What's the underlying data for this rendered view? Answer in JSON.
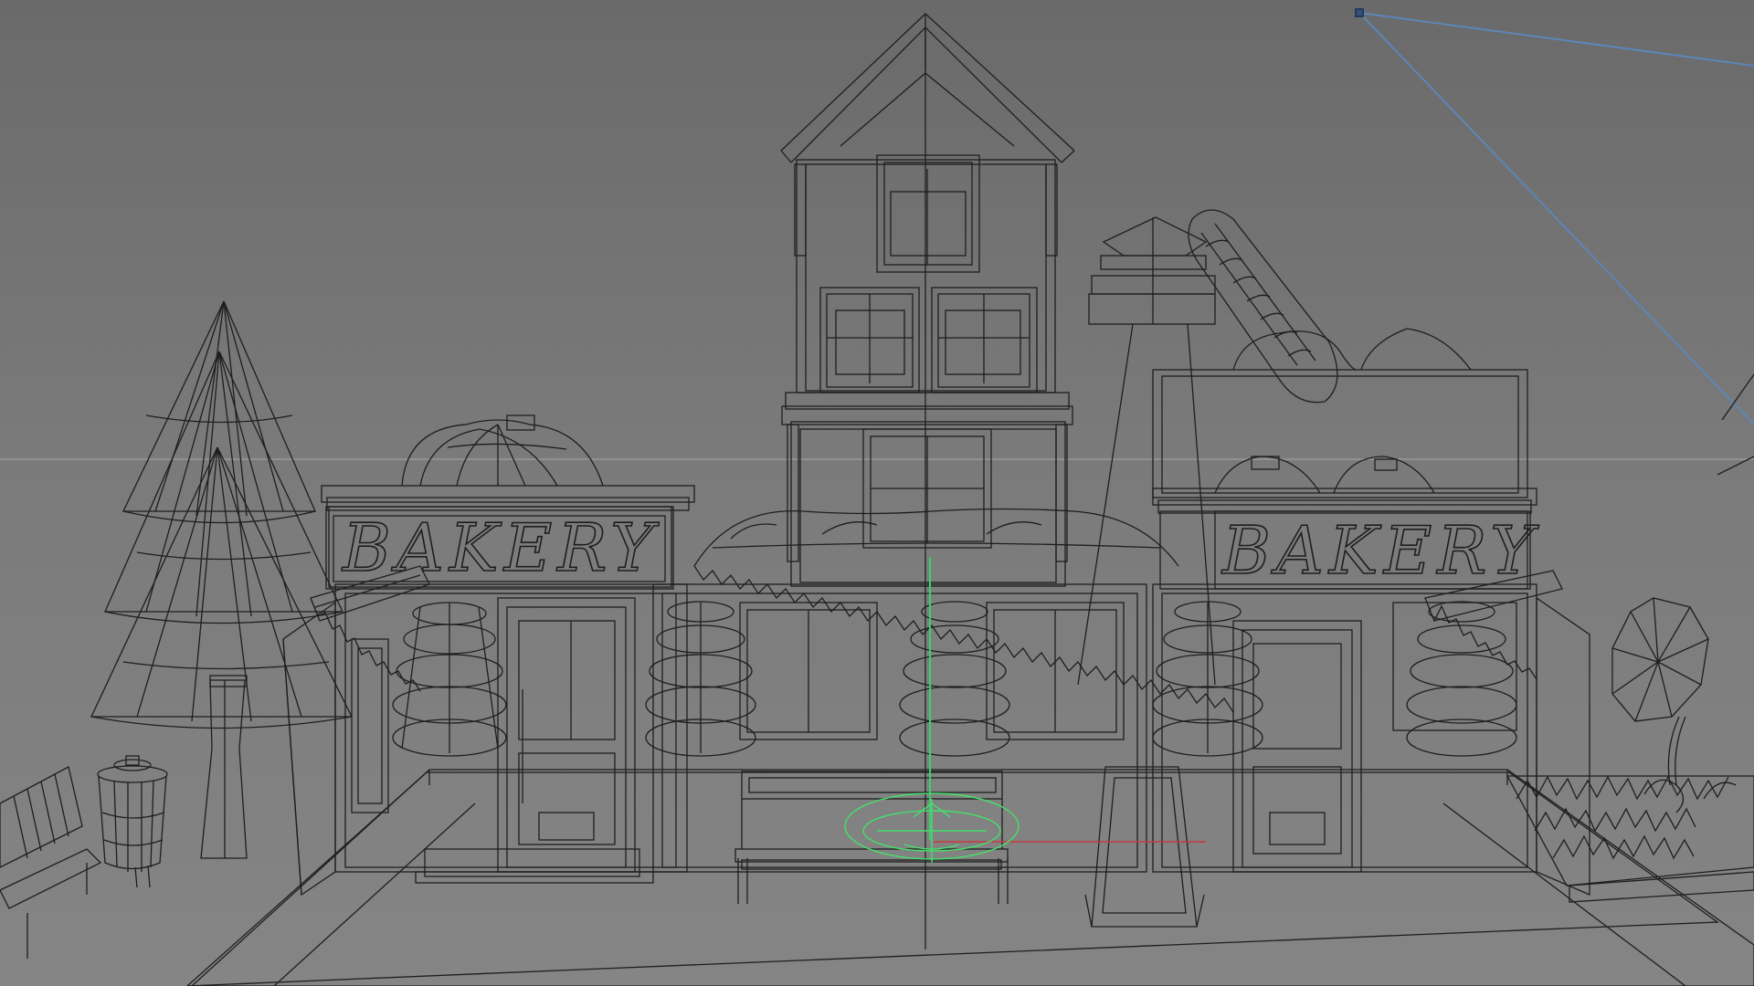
{
  "viewport": {
    "shading_mode": "wireframe",
    "background_color": "#747474",
    "wire_color": "#1e1e1e",
    "selection_color": "#45e06a",
    "camera_line_color": "#5c86b8",
    "x_axis_color": "#c43a3a",
    "y_axis_color": "#36d36a"
  },
  "scene": {
    "signs": [
      {
        "text": "BAKERY"
      },
      {
        "text": "BAKERY"
      }
    ]
  }
}
